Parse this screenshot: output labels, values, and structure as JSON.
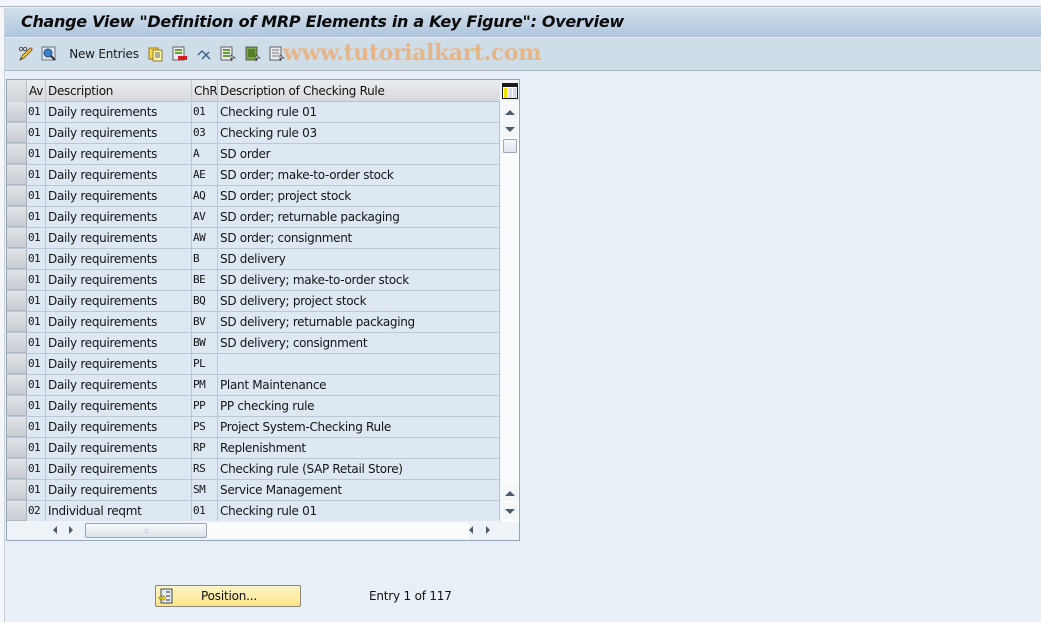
{
  "window": {
    "title": "Change View \"Definition of MRP Elements in a Key Figure\": Overview"
  },
  "toolbar": {
    "buttons": [
      {
        "name": "display-change-icon",
        "label": ""
      },
      {
        "name": "details-icon",
        "label": ""
      },
      {
        "name": "new-entries",
        "label": "New Entries"
      },
      {
        "name": "copy-icon",
        "label": ""
      },
      {
        "name": "delete-icon",
        "label": ""
      },
      {
        "name": "undo-change-icon",
        "label": ""
      },
      {
        "name": "select-all-icon",
        "label": ""
      },
      {
        "name": "select-block-icon",
        "label": ""
      },
      {
        "name": "deselect-all-icon",
        "label": ""
      }
    ],
    "watermark": "www.tutorialkart.com"
  },
  "table": {
    "columns": [
      {
        "key": "av",
        "label": "Av"
      },
      {
        "key": "description",
        "label": "Description"
      },
      {
        "key": "chr",
        "label": "ChR"
      },
      {
        "key": "checking_rule_desc",
        "label": "Description of Checking Rule"
      }
    ],
    "rows": [
      {
        "av": "01",
        "description": "Daily requirements",
        "chr": "01",
        "checking_rule_desc": "Checking rule 01"
      },
      {
        "av": "01",
        "description": "Daily requirements",
        "chr": "03",
        "checking_rule_desc": "Checking rule 03"
      },
      {
        "av": "01",
        "description": "Daily requirements",
        "chr": "A",
        "checking_rule_desc": "SD order"
      },
      {
        "av": "01",
        "description": "Daily requirements",
        "chr": "AE",
        "checking_rule_desc": "SD order; make-to-order stock"
      },
      {
        "av": "01",
        "description": "Daily requirements",
        "chr": "AQ",
        "checking_rule_desc": "SD order; project stock"
      },
      {
        "av": "01",
        "description": "Daily requirements",
        "chr": "AV",
        "checking_rule_desc": "SD order; returnable packaging"
      },
      {
        "av": "01",
        "description": "Daily requirements",
        "chr": "AW",
        "checking_rule_desc": "SD order; consignment"
      },
      {
        "av": "01",
        "description": "Daily requirements",
        "chr": "B",
        "checking_rule_desc": "SD delivery"
      },
      {
        "av": "01",
        "description": "Daily requirements",
        "chr": "BE",
        "checking_rule_desc": "SD delivery; make-to-order stock"
      },
      {
        "av": "01",
        "description": "Daily requirements",
        "chr": "BQ",
        "checking_rule_desc": "SD delivery; project stock"
      },
      {
        "av": "01",
        "description": "Daily requirements",
        "chr": "BV",
        "checking_rule_desc": "SD delivery; returnable packaging"
      },
      {
        "av": "01",
        "description": "Daily requirements",
        "chr": "BW",
        "checking_rule_desc": "SD delivery; consignment"
      },
      {
        "av": "01",
        "description": "Daily requirements",
        "chr": "PL",
        "checking_rule_desc": ""
      },
      {
        "av": "01",
        "description": "Daily requirements",
        "chr": "PM",
        "checking_rule_desc": "Plant Maintenance"
      },
      {
        "av": "01",
        "description": "Daily requirements",
        "chr": "PP",
        "checking_rule_desc": "PP checking rule"
      },
      {
        "av": "01",
        "description": "Daily requirements",
        "chr": "PS",
        "checking_rule_desc": "Project System-Checking Rule"
      },
      {
        "av": "01",
        "description": "Daily requirements",
        "chr": "RP",
        "checking_rule_desc": "Replenishment"
      },
      {
        "av": "01",
        "description": "Daily requirements",
        "chr": "RS",
        "checking_rule_desc": "Checking rule (SAP Retail Store)"
      },
      {
        "av": "01",
        "description": "Daily requirements",
        "chr": "SM",
        "checking_rule_desc": "Service Management"
      },
      {
        "av": "02",
        "description": "Individual reqmt",
        "chr": "01",
        "checking_rule_desc": "Checking rule 01"
      }
    ]
  },
  "footer": {
    "position_button": "Position...",
    "entry_info": "Entry 1 of 117"
  }
}
